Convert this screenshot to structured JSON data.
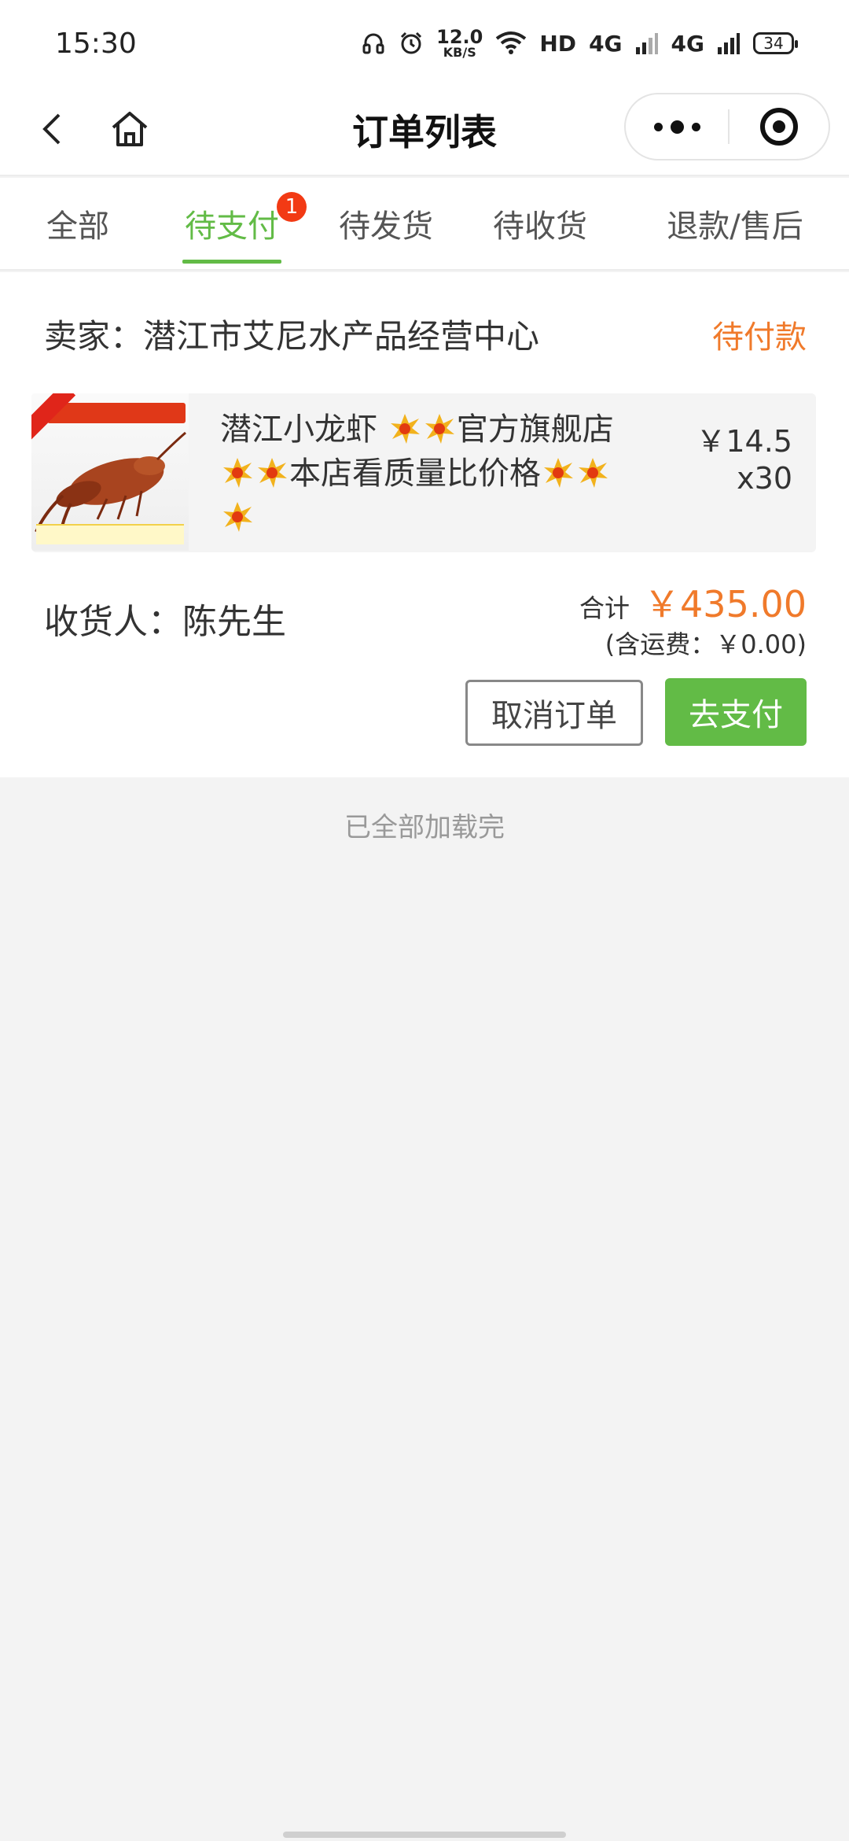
{
  "status_bar": {
    "time": "15:30",
    "net_speed_value": "12.0",
    "net_speed_unit": "KB/S",
    "hd_label": "HD",
    "network_1": "4G",
    "network_2": "4G",
    "battery": "34",
    "icons": [
      "headset-icon",
      "alarm-icon",
      "wifi-icon",
      "signal-icon",
      "battery-icon"
    ]
  },
  "nav": {
    "title": "订单列表",
    "icons": [
      "back-arrow-icon",
      "home-icon",
      "more-dots-icon",
      "target-icon"
    ]
  },
  "tabs": {
    "items": [
      "全部",
      "待支付",
      "待发货",
      "待收货",
      "退款/售后"
    ],
    "active_index": 1,
    "badge": "1"
  },
  "order": {
    "seller": "卖家：潜江市艾尼水产品经营中心",
    "status": "待付款",
    "product": {
      "title_part1": "潜江小龙虾 ",
      "title_part2": "官方旗舰店",
      "title_part3": "本店看质量比价格",
      "title_emoji": "collision-emoji-icon",
      "price": "￥14.5",
      "quantity": "x30",
      "thumbnail": "crayfish-product-image"
    },
    "receiver": "收货人：陈先生",
    "total_label": "合计",
    "total_amount": "￥435.00",
    "shipping": "(含运费：￥0.00)",
    "cancel_label": "取消订单",
    "pay_label": "去支付"
  },
  "footer": {
    "loaded_text": "已全部加载完"
  },
  "colors": {
    "accent_green": "#62bb46",
    "accent_orange": "#f07a2b",
    "badge_red": "#f23a14"
  }
}
